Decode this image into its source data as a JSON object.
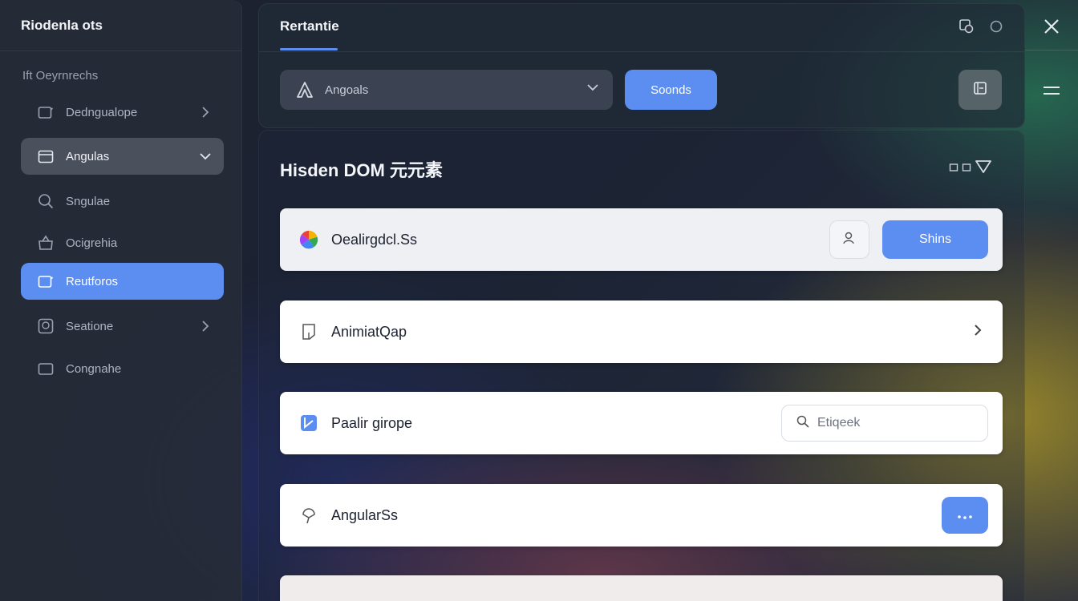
{
  "sidebar": {
    "title": "Riodenla ots",
    "section_label": "Ift Oeyrnrechs",
    "items": [
      {
        "label": "Dedngualope",
        "icon": "folder-icon",
        "trailing": "chevron-right"
      },
      {
        "label": "Angulas",
        "icon": "calendar-icon",
        "trailing": "chevron-down",
        "state": "expanded"
      },
      {
        "label": "Sngulae",
        "icon": "search-icon"
      },
      {
        "label": "Ocigrehia",
        "icon": "bag-icon"
      },
      {
        "label": "Reutforos",
        "icon": "folder-icon",
        "state": "selected"
      },
      {
        "label": "Seatione",
        "icon": "image-icon",
        "trailing": "chevron-right"
      },
      {
        "label": "Congnahe",
        "icon": "folder-icon"
      }
    ]
  },
  "topbar": {
    "tab_label": "Rertantie",
    "select_value": "Angoals",
    "primary_button": "Soonds"
  },
  "main": {
    "title": "Hisden DOM 元元素",
    "cards": [
      {
        "label": "Oealirgdcl.Ss",
        "icon": "color-wheel-icon",
        "action": "Shins"
      },
      {
        "label": "AnimiatQap",
        "icon": "document-icon"
      },
      {
        "label": "Paalir girope",
        "icon": "checkbox-icon",
        "search_placeholder": "Etiqeek"
      },
      {
        "label": "AngularSs",
        "icon": "pin-icon"
      }
    ]
  },
  "colors": {
    "accent": "#5b8ef0",
    "sidebar_bg": "#262b38",
    "card_bg": "#ffffff"
  }
}
